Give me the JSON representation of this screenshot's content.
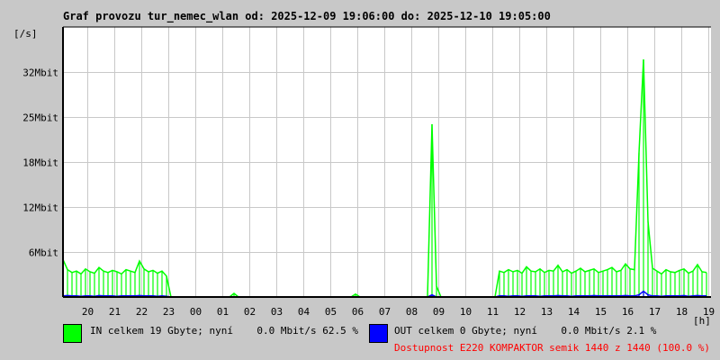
{
  "chart_data": {
    "type": "line",
    "title": "Graf provozu tur_nemec_wlan od: 2025-12-09 19:06:00 do: 2025-12-10 19:05:00",
    "ylabel": "[/s]",
    "xlabel": "[h]",
    "y_unit": "Mbit/s",
    "ylim": [
      0,
      37.5
    ],
    "y_ticks": [
      {
        "value": 6.25,
        "label": "6Mbit"
      },
      {
        "value": 12.5,
        "label": "12Mbit"
      },
      {
        "value": 18.75,
        "label": "18Mbit"
      },
      {
        "value": 25,
        "label": "25Mbit"
      },
      {
        "value": 31.25,
        "label": "32Mbit"
      }
    ],
    "x_start": "19:06",
    "x_step_minutes": 10,
    "x_ticks": [
      "20",
      "21",
      "22",
      "23",
      "00",
      "01",
      "02",
      "03",
      "04",
      "05",
      "06",
      "07",
      "08",
      "09",
      "10",
      "11",
      "12",
      "13",
      "14",
      "15",
      "16",
      "17",
      "18",
      "19"
    ],
    "grid": true,
    "series": [
      {
        "name": "IN",
        "color": "#00ff00",
        "values": [
          5.2,
          3.8,
          3.4,
          3.6,
          3.2,
          3.9,
          3.5,
          3.3,
          4.1,
          3.6,
          3.4,
          3.7,
          3.5,
          3.2,
          3.8,
          3.6,
          3.4,
          5.0,
          3.9,
          3.5,
          3.7,
          3.3,
          3.6,
          2.9,
          0,
          0,
          0,
          0,
          0,
          0,
          0,
          0,
          0,
          0,
          0,
          0,
          0,
          0,
          0.5,
          0,
          0,
          0,
          0,
          0,
          0,
          0,
          0,
          0,
          0,
          0,
          0,
          0,
          0,
          0,
          0,
          0,
          0,
          0,
          0,
          0,
          0,
          0,
          0,
          0,
          0,
          0.4,
          0,
          0,
          0,
          0,
          0,
          0,
          0,
          0,
          0,
          0,
          0,
          0,
          0,
          0,
          0,
          0,
          24.0,
          1.5,
          0,
          0,
          0,
          0,
          0,
          0,
          0,
          0,
          0,
          0,
          0,
          0,
          0,
          3.6,
          3.4,
          3.8,
          3.5,
          3.7,
          3.3,
          4.2,
          3.6,
          3.5,
          3.9,
          3.4,
          3.7,
          3.6,
          4.4,
          3.5,
          3.8,
          3.3,
          3.6,
          4.0,
          3.5,
          3.7,
          3.9,
          3.4,
          3.6,
          3.8,
          4.1,
          3.5,
          3.7,
          4.6,
          3.9,
          3.8,
          20.0,
          33.0,
          10.5,
          4.0,
          3.6,
          3.2,
          3.8,
          3.5,
          3.4,
          3.7,
          3.9,
          3.3,
          3.6,
          4.5,
          3.5,
          3.4
        ]
      },
      {
        "name": "OUT",
        "color": "#0000ff",
        "values": [
          0.15,
          0.2,
          0.15,
          0.15,
          0.1,
          0.15,
          0.15,
          0.1,
          0.2,
          0.15,
          0.15,
          0.15,
          0.1,
          0.15,
          0.15,
          0.15,
          0.15,
          0.2,
          0.15,
          0.15,
          0.15,
          0.1,
          0.15,
          0.1,
          0,
          0,
          0,
          0,
          0,
          0,
          0,
          0,
          0,
          0,
          0,
          0,
          0,
          0,
          0,
          0,
          0,
          0,
          0,
          0,
          0,
          0,
          0,
          0,
          0,
          0,
          0,
          0,
          0,
          0,
          0,
          0,
          0,
          0,
          0,
          0,
          0,
          0,
          0,
          0,
          0,
          0,
          0,
          0,
          0,
          0,
          0,
          0,
          0,
          0,
          0,
          0,
          0,
          0,
          0,
          0,
          0,
          0,
          0.3,
          0,
          0,
          0,
          0,
          0,
          0,
          0,
          0,
          0,
          0,
          0,
          0,
          0,
          0,
          0.15,
          0.15,
          0.1,
          0.15,
          0.15,
          0.1,
          0.15,
          0.15,
          0.15,
          0.1,
          0.15,
          0.15,
          0.15,
          0.2,
          0.15,
          0.15,
          0.1,
          0.15,
          0.15,
          0.15,
          0.15,
          0.2,
          0.15,
          0.15,
          0.15,
          0.15,
          0.15,
          0.15,
          0.2,
          0.15,
          0.15,
          0.3,
          0.8,
          0.3,
          0.15,
          0.15,
          0.1,
          0.15,
          0.15,
          0.15,
          0.15,
          0.2,
          0.1,
          0.15,
          0.2,
          0.15,
          0.15
        ]
      }
    ],
    "legend": {
      "in_text": "IN celkem 19 Gbyte; nyní    0.0 Mbit/s 62.5 %",
      "out_text": "OUT celkem 0 Gbyte; nyní    0.0 Mbit/s 2.1 %",
      "availability": "Dostupnost E220 KOMPAKTOR semik 1440 z 1440 (100.0 %)"
    }
  }
}
